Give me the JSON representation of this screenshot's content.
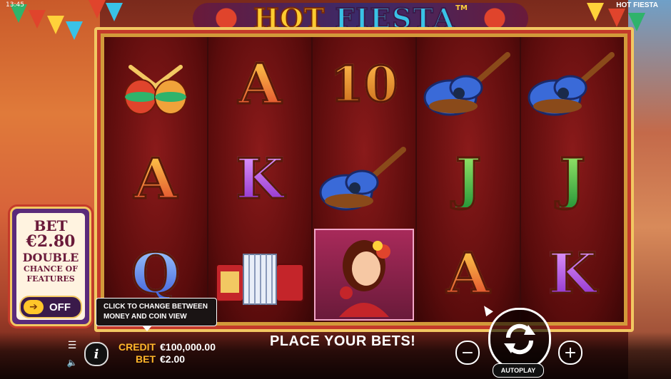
{
  "status_bar": {
    "clock": "13:45",
    "game_name": "HOT FIESTA"
  },
  "logo": {
    "hot": "HOT",
    "fiesta": "FIESTA",
    "tm": "TM"
  },
  "colors": {
    "accent_gold": "#f2c862",
    "frame_red": "#c43a2a",
    "credit_label": "#ffb62a"
  },
  "reels": [
    [
      "maracas-icon",
      "A",
      "Q"
    ],
    [
      "A",
      "K",
      "accordion-icon"
    ],
    [
      "10",
      "guitar-icon",
      "lady-wild-icon"
    ],
    [
      "guitar-icon",
      "J",
      "A"
    ],
    [
      "guitar-icon",
      "J",
      "K"
    ]
  ],
  "bet_panel": {
    "bet_label": "BET",
    "bet_amount": "€2.80",
    "double_label": "DOUBLE",
    "chance_label": "CHANCE OF FEATURES",
    "toggle_state": "OFF"
  },
  "tooltip": {
    "line1": "CLICK TO CHANGE BETWEEN",
    "line2": "MONEY AND COIN VIEW"
  },
  "footer": {
    "credit_label": "CREDIT",
    "credit_value": "€100,000.00",
    "bet_label": "BET",
    "bet_value": "€2.00",
    "message": "PLACE YOUR BETS!",
    "autoplay_label": "AUTOPLAY",
    "minus_label": "−",
    "plus_label": "+",
    "info_label": "i"
  }
}
